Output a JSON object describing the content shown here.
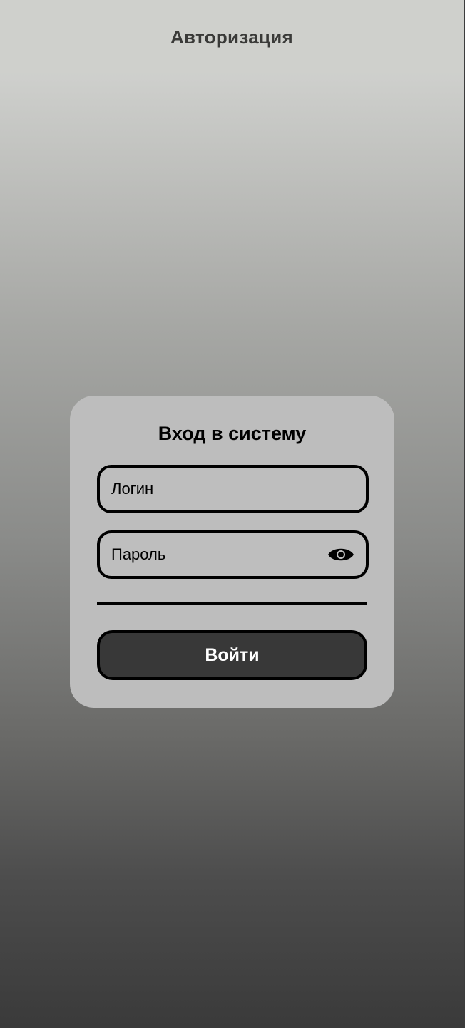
{
  "header": {
    "title": "Авторизация"
  },
  "login_card": {
    "title": "Вход в систему",
    "login_field": {
      "placeholder": "Логин",
      "value": ""
    },
    "password_field": {
      "placeholder": "Пароль",
      "value": "",
      "toggle_icon": "eye-icon"
    },
    "submit_label": "Войти"
  },
  "colors": {
    "card_background": "#bdbdbd",
    "button_background": "#383838",
    "button_text": "#ffffff",
    "border": "#000000",
    "header_background": "#cfd0cc",
    "header_text": "#3a3a38"
  }
}
